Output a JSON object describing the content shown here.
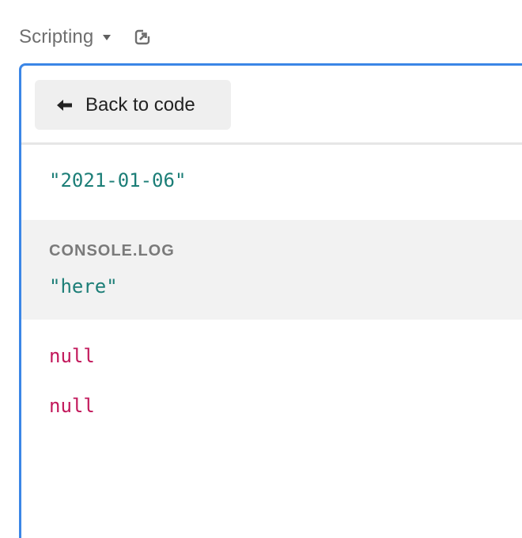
{
  "header": {
    "title": "Scripting",
    "dropdown_icon": "caret-down-icon",
    "popout_icon": "external-link-icon"
  },
  "toolbar": {
    "back_label": "Back to code",
    "back_icon": "arrow-left-icon"
  },
  "output": {
    "result": "\"2021-01-06\"",
    "console": {
      "label": "CONSOLE.LOG",
      "value": "\"here\""
    },
    "nulls": [
      "null",
      "null"
    ]
  },
  "colors": {
    "accent_border": "#3b86e6",
    "string": "#1c7e77",
    "null": "#c2185b",
    "muted_text": "#6f6f6f"
  }
}
